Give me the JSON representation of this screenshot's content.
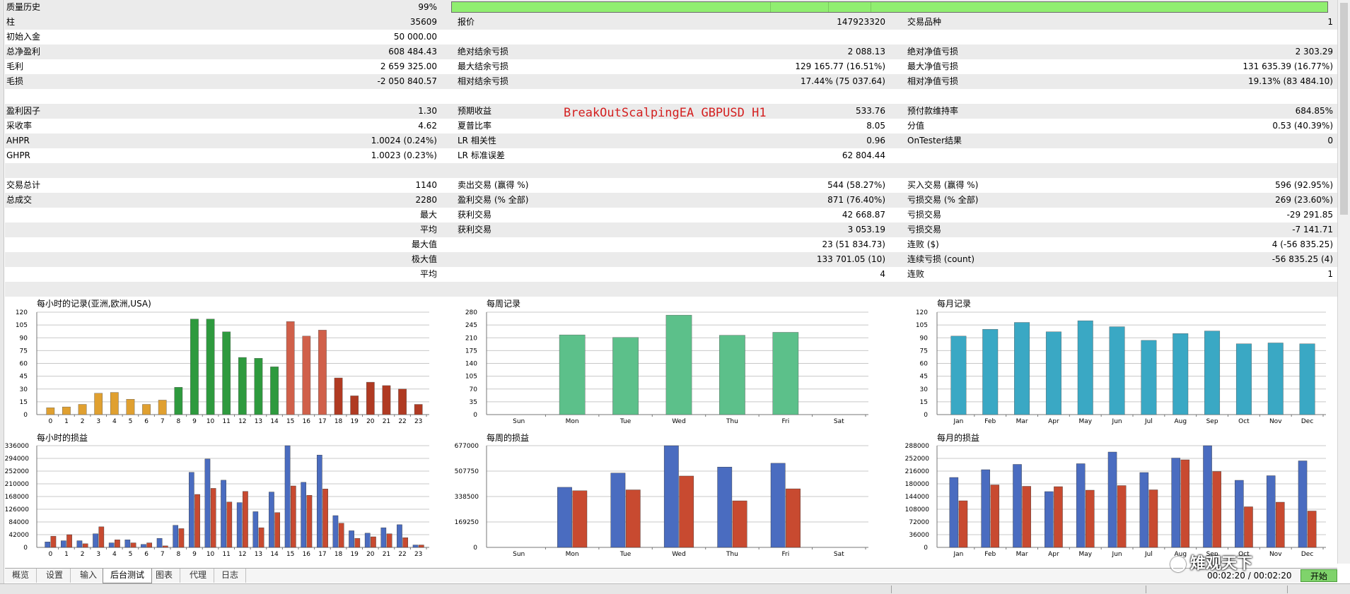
{
  "stats": {
    "rows": [
      {
        "shade": true,
        "c1": [
          "质量历史",
          "99%"
        ],
        "c2": null,
        "c3": null,
        "quality_bar": true
      },
      {
        "shade": true,
        "c1": [
          "柱",
          "35609"
        ],
        "c2": [
          "报价",
          "147923320"
        ],
        "c3": [
          "交易品种",
          "1"
        ]
      },
      {
        "shade": false,
        "c1": [
          "初始入金",
          "50 000.00"
        ],
        "c2": null,
        "c3": null
      },
      {
        "shade": true,
        "c1": [
          "总净盈利",
          "608 484.43"
        ],
        "c2": [
          "绝对结余亏损",
          "2 088.13"
        ],
        "c3": [
          "绝对净值亏损",
          "2 303.29"
        ]
      },
      {
        "shade": false,
        "c1": [
          "毛利",
          "2 659 325.00"
        ],
        "c2": [
          "最大结余亏损",
          "129 165.77 (16.51%)"
        ],
        "c3": [
          "最大净值亏损",
          "131 635.39 (16.77%)"
        ]
      },
      {
        "shade": true,
        "c1": [
          "毛损",
          "-2 050 840.57"
        ],
        "c2": [
          "相对结余亏损",
          "17.44% (75 037.64)"
        ],
        "c3": [
          "相对净值亏损",
          "19.13% (83 484.10)"
        ]
      },
      {
        "shade": false,
        "c1": null,
        "c2": null,
        "c3": null
      },
      {
        "shade": true,
        "c1": [
          "盈利因子",
          "1.30"
        ],
        "c2": [
          "预期收益",
          "533.76"
        ],
        "c3": [
          "预付款维持率",
          "684.85%"
        ]
      },
      {
        "shade": false,
        "c1": [
          "采收率",
          "4.62"
        ],
        "c2": [
          "夏普比率",
          "8.05"
        ],
        "c3": [
          "分值",
          "0.53 (40.39%)"
        ]
      },
      {
        "shade": true,
        "c1": [
          "AHPR",
          "1.0024 (0.24%)"
        ],
        "c2": [
          "LR 相关性",
          "0.96"
        ],
        "c3": [
          "OnTester结果",
          "0"
        ]
      },
      {
        "shade": false,
        "c1": [
          "GHPR",
          "1.0023 (0.23%)"
        ],
        "c2": [
          "LR 标准误差",
          "62 804.44"
        ],
        "c3": null
      },
      {
        "shade": true,
        "c1": null,
        "c2": null,
        "c3": null
      },
      {
        "shade": false,
        "c1": [
          "交易总计",
          "1140"
        ],
        "c2": [
          "卖出交易 (赢得 %)",
          "544 (58.27%)"
        ],
        "c3": [
          "买入交易 (赢得 %)",
          "596 (92.95%)"
        ]
      },
      {
        "shade": true,
        "c1": [
          "总成交",
          "2280"
        ],
        "c2": [
          "盈利交易 (% 全部)",
          "871 (76.40%)"
        ],
        "c3": [
          "亏损交易 (% 全部)",
          "269 (23.60%)"
        ]
      },
      {
        "shade": false,
        "c1": [
          "",
          "最大"
        ],
        "c2": [
          "获利交易",
          "42 668.87"
        ],
        "c3": [
          "亏损交易",
          "-29 291.85"
        ]
      },
      {
        "shade": true,
        "c1": [
          "",
          "平均"
        ],
        "c2": [
          "获利交易",
          "3 053.19"
        ],
        "c3": [
          "亏损交易",
          "-7 141.71"
        ]
      },
      {
        "shade": false,
        "c1": [
          "",
          "最大值"
        ],
        "c2": [
          "",
          "23 (51 834.73)"
        ],
        "c3": [
          "连败 ($)",
          "4 (-56 835.25)"
        ]
      },
      {
        "shade": true,
        "c1": [
          "",
          "极大值"
        ],
        "c2": [
          "",
          "133 701.05 (10)"
        ],
        "c3": [
          "连续亏损 (count)",
          "-56 835.25 (4)"
        ]
      },
      {
        "shade": false,
        "c1": [
          "",
          "平均"
        ],
        "c2": [
          "",
          "4"
        ],
        "c3": [
          "连败",
          "1"
        ]
      },
      {
        "shade": true,
        "c1": null,
        "c2": null,
        "c3": null
      }
    ]
  },
  "ea_title": "BreakOutScalpingEA GBPUSD H1",
  "chart_data": [
    {
      "type": "bar",
      "title": "每小时的记录(亚洲,欧洲,USA)",
      "categories": [
        "0",
        "1",
        "2",
        "3",
        "4",
        "5",
        "6",
        "7",
        "8",
        "9",
        "10",
        "11",
        "12",
        "13",
        "14",
        "15",
        "16",
        "17",
        "18",
        "19",
        "20",
        "21",
        "22",
        "23"
      ],
      "values": [
        8,
        9,
        12,
        25,
        26,
        18,
        12,
        17,
        32,
        112,
        112,
        97,
        67,
        66,
        56,
        109,
        92,
        99,
        43,
        22,
        38,
        34,
        30,
        12
      ],
      "bar_colors": [
        "orange",
        "orange",
        "orange",
        "orange",
        "orange",
        "orange",
        "orange",
        "orange",
        "green",
        "green",
        "green",
        "green",
        "green",
        "green",
        "green",
        "red",
        "red",
        "red",
        "darkred",
        "darkred",
        "darkred",
        "darkred",
        "darkred",
        "darkred"
      ],
      "yticks": [
        "120",
        "105",
        "90",
        "75",
        "60",
        "45",
        "30",
        "15",
        "0"
      ],
      "ylim": [
        0,
        120
      ],
      "xlabel": "",
      "ylabel": ""
    },
    {
      "type": "bar",
      "title": "每周记录",
      "categories": [
        "Sun",
        "Mon",
        "Tue",
        "Wed",
        "Thu",
        "Fri",
        "Sat"
      ],
      "values": [
        0,
        218,
        211,
        272,
        217,
        225,
        0
      ],
      "yticks": [
        "280",
        "245",
        "210",
        "175",
        "140",
        "105",
        "70",
        "35",
        "0"
      ],
      "ylim": [
        0,
        280
      ],
      "xlabel": "",
      "ylabel": ""
    },
    {
      "type": "bar",
      "title": "每月记录",
      "categories": [
        "Jan",
        "Feb",
        "Mar",
        "Apr",
        "May",
        "Jun",
        "Jul",
        "Aug",
        "Sep",
        "Oct",
        "Nov",
        "Dec"
      ],
      "values": [
        92,
        100,
        108,
        97,
        110,
        103,
        87,
        95,
        98,
        83,
        84,
        83
      ],
      "yticks": [
        "120",
        "105",
        "90",
        "75",
        "60",
        "45",
        "30",
        "15",
        "0"
      ],
      "ylim": [
        0,
        120
      ],
      "xlabel": "",
      "ylabel": ""
    },
    {
      "type": "bar",
      "title": "每小时的损益",
      "categories": [
        "0",
        "1",
        "2",
        "3",
        "4",
        "5",
        "6",
        "7",
        "8",
        "9",
        "10",
        "11",
        "12",
        "13",
        "14",
        "15",
        "16",
        "17",
        "18",
        "19",
        "20",
        "21",
        "22",
        "23"
      ],
      "series": [
        {
          "values": [
            18000,
            22000,
            22000,
            45000,
            15000,
            25000,
            10000,
            30000,
            73000,
            248000,
            292000,
            222000,
            148000,
            118000,
            183000,
            336000,
            215000,
            305000,
            105000,
            55000,
            47000,
            65000,
            75000,
            8000
          ],
          "color": "blue"
        },
        {
          "values": [
            37000,
            42000,
            12000,
            68000,
            25000,
            15000,
            15000,
            5000,
            62000,
            175000,
            195000,
            150000,
            185000,
            65000,
            115000,
            203000,
            172000,
            193000,
            80000,
            30000,
            35000,
            45000,
            32000,
            8000
          ],
          "color": "red"
        }
      ],
      "yticks": [
        "336000",
        "294000",
        "252000",
        "210000",
        "168000",
        "126000",
        "84000",
        "42000",
        "0"
      ],
      "ylim": [
        0,
        336000
      ],
      "xlabel": "",
      "ylabel": ""
    },
    {
      "type": "bar",
      "title": "每周的损益",
      "categories": [
        "Sun",
        "Mon",
        "Tue",
        "Wed",
        "Thu",
        "Fri",
        "Sat"
      ],
      "series": [
        {
          "values": [
            0,
            400000,
            495000,
            677000,
            535000,
            560000,
            0
          ],
          "color": "blue"
        },
        {
          "values": [
            0,
            377000,
            383000,
            475000,
            310000,
            390000,
            0
          ],
          "color": "red"
        }
      ],
      "yticks": [
        "677000",
        "507750",
        "338500",
        "169250",
        "0"
      ],
      "ylim": [
        0,
        677000
      ],
      "xlabel": "",
      "ylabel": ""
    },
    {
      "type": "bar",
      "title": "每月的损益",
      "categories": [
        "Jan",
        "Feb",
        "Mar",
        "Apr",
        "May",
        "Jun",
        "Jul",
        "Aug",
        "Sep",
        "Oct",
        "Nov",
        "Dec"
      ],
      "series": [
        {
          "values": [
            198000,
            220000,
            235000,
            158000,
            237000,
            270000,
            212000,
            253000,
            288000,
            190000,
            203000,
            245000
          ],
          "color": "blue"
        },
        {
          "values": [
            132000,
            177000,
            173000,
            172000,
            162000,
            175000,
            163000,
            248000,
            215000,
            115000,
            128000,
            103000
          ],
          "color": "red"
        }
      ],
      "yticks": [
        "288000",
        "252000",
        "216000",
        "180000",
        "144000",
        "108000",
        "72000",
        "36000",
        "0"
      ],
      "ylim": [
        0,
        288000
      ],
      "xlabel": "",
      "ylabel": ""
    }
  ],
  "tabs": [
    "概览",
    "设置",
    "输入",
    "后台测试",
    "图表",
    "代理",
    "日志"
  ],
  "active_tab": "后台测试",
  "time_display": "00:02:20 / 00:02:20",
  "start_label": "开始",
  "watermark": "雉观天下",
  "colors": {
    "orange": "#e0a030",
    "green": "#2e9a3e",
    "red": "#d0604a",
    "darkred": "#b03a22",
    "weekly": "#5cc08a",
    "monthly": "#3aa8c4",
    "blue": "#4a6cc0",
    "pl_red": "#c84a30",
    "quality_bar": "#90ee70",
    "start_button": "#7fd36b",
    "title_red": "#d42020"
  }
}
